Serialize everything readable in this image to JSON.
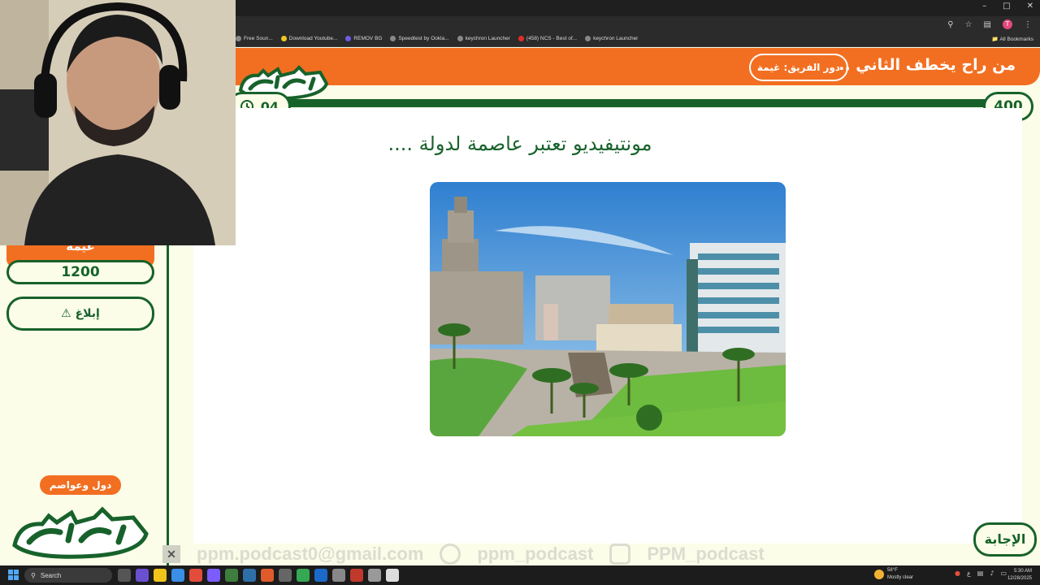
{
  "browser": {
    "bookmarks": [
      {
        "label": "Free Soun..."
      },
      {
        "label": "Download Youtube..."
      },
      {
        "label": "REMOV BG"
      },
      {
        "label": "Speedtest by Ookla..."
      },
      {
        "label": "keychron Launcher"
      },
      {
        "label": "(458) NCS - Best of..."
      },
      {
        "label": "keychron Launcher"
      }
    ],
    "all_bookmarks": "All Bookmarks",
    "profile_initial": "T"
  },
  "header": {
    "title": "من راح يخطف الثاني ..",
    "team_turn": "دور الفريق: غيمة"
  },
  "game": {
    "score": "400",
    "timer": "04",
    "question": "مونتيفيديو تعتبر عاصمة لدولة ....",
    "answer_button": "الإجابة"
  },
  "sidebar": {
    "team_name": "غيمة",
    "team_score": "1200",
    "report_label": "إبلاغ",
    "category": "دول وعواصم"
  },
  "watermark": {
    "email": "ppm.podcast0@gmail.com",
    "snapchat": "ppm_podcast",
    "instagram": "PPM_podcast"
  },
  "taskbar": {
    "search_label": "Search",
    "weather_temp": "58°F",
    "weather_desc": "Mostly clear",
    "lang": "ع",
    "time": "5:30 AM",
    "date": "12/28/2025"
  },
  "colors": {
    "orange": "#f26f21",
    "green": "#17622b",
    "cream": "#fbfde8"
  }
}
